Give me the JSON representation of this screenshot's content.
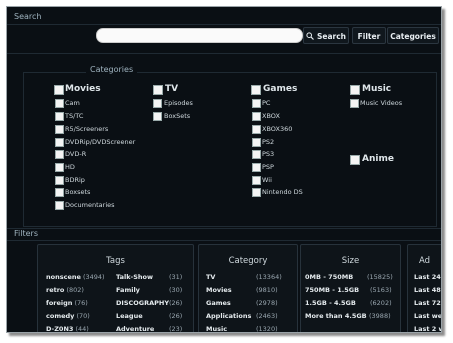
{
  "sections": {
    "search": "Search",
    "filters": "Filters"
  },
  "toolbar": {
    "search_label": "Search",
    "filter_label": "Filter",
    "categories_label": "Categories"
  },
  "categories": {
    "legend": "Categories",
    "groups": [
      {
        "name": "Movies",
        "items": [
          "Cam",
          "TS/TC",
          "R5/Screeners",
          "DVDRip/DVDScreener",
          "DVD-R",
          "HD",
          "BDRip",
          "Boxsets",
          "Documentaries"
        ]
      },
      {
        "name": "TV",
        "items": [
          "Episodes",
          "BoxSets"
        ]
      },
      {
        "name": "Games",
        "items": [
          "PC",
          "XBOX",
          "XBOX360",
          "PS2",
          "PS3",
          "PSP",
          "Wii",
          "Nintendo DS"
        ]
      },
      {
        "name": "Music",
        "items": [
          "Music Videos"
        ]
      },
      {
        "name": "Anime",
        "items": []
      }
    ]
  },
  "tags": {
    "title": "Tags",
    "col1": [
      {
        "label": "nonscene",
        "count": "(3494)"
      },
      {
        "label": "retro",
        "count": "(802)"
      },
      {
        "label": "foreign",
        "count": "(76)"
      },
      {
        "label": "comedy",
        "count": "(70)"
      },
      {
        "label": "D-Z0N3",
        "count": "(44)"
      }
    ],
    "col2": [
      {
        "label": "Talk-Show",
        "count": "(31)"
      },
      {
        "label": "Family",
        "count": "(30)"
      },
      {
        "label": "DISCOGRAPHY",
        "count": "(26)"
      },
      {
        "label": "League",
        "count": "(26)"
      },
      {
        "label": "Adventure",
        "count": "(23)"
      }
    ]
  },
  "category_panel": {
    "title": "Category",
    "rows": [
      {
        "label": "TV",
        "count": "(13364)"
      },
      {
        "label": "Movies",
        "count": "(9810)"
      },
      {
        "label": "Games",
        "count": "(2978)"
      },
      {
        "label": "Applications",
        "count": "(2463)"
      },
      {
        "label": "Music",
        "count": "(1320)"
      }
    ]
  },
  "size_panel": {
    "title": "Size",
    "rows": [
      {
        "label": "0MB - 750MB",
        "count": "(15825)"
      },
      {
        "label": "750MB - 1.5GB",
        "count": "(5163)"
      },
      {
        "label": "1.5GB - 4.5GB",
        "count": "(6202)"
      },
      {
        "label": "More than 4.5GB",
        "count": "(3988)"
      }
    ]
  },
  "added_panel": {
    "title": "Ad",
    "rows": [
      "Last 24",
      "Last 48",
      "Last 72",
      "Last we",
      "Last 2 w"
    ]
  },
  "icons": {
    "search": "magnifier-icon"
  }
}
